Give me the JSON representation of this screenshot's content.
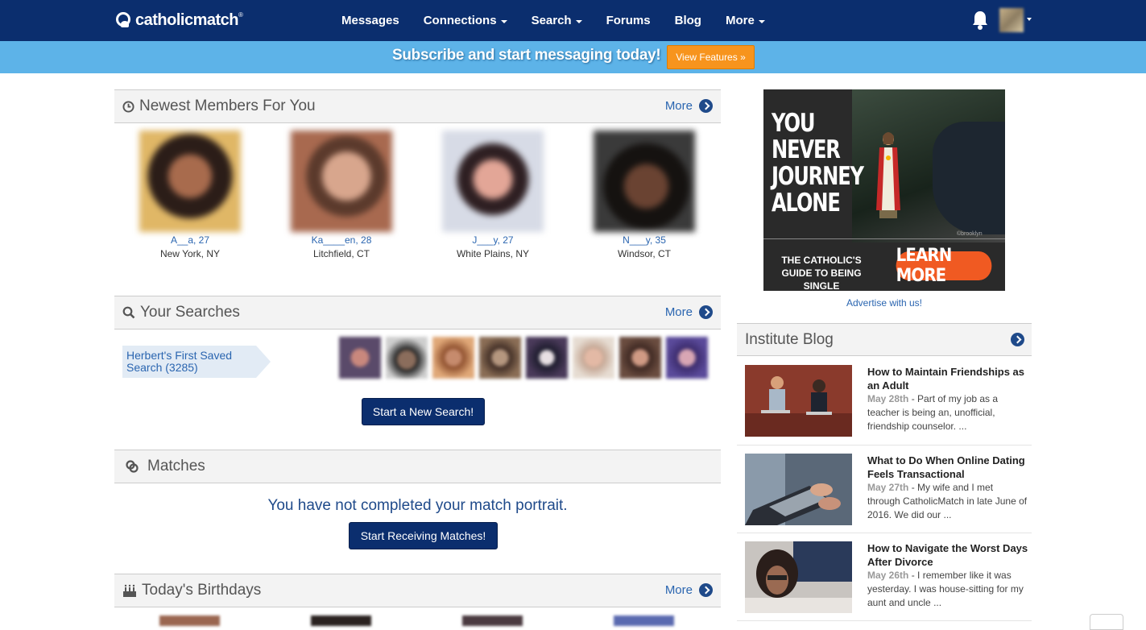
{
  "brand": {
    "name": "catholicmatch",
    "trademark": "®"
  },
  "nav": {
    "items": [
      {
        "label": "Messages",
        "dropdown": false
      },
      {
        "label": "Connections",
        "dropdown": true
      },
      {
        "label": "Search",
        "dropdown": true
      },
      {
        "label": "Forums",
        "dropdown": false
      },
      {
        "label": "Blog",
        "dropdown": false
      },
      {
        "label": "More",
        "dropdown": true
      }
    ],
    "icons": [
      "bell-icon",
      "avatar"
    ]
  },
  "promo": {
    "text": "Subscribe and start messaging today!",
    "button": "View Features »"
  },
  "newest": {
    "title": "Newest Members For You",
    "more": "More",
    "members": [
      {
        "name": "A__a, 27",
        "location": "New York, NY"
      },
      {
        "name": "Ka____en, 28",
        "location": "Litchfield, CT"
      },
      {
        "name": "J___y, 27",
        "location": "White Plains, NY"
      },
      {
        "name": "N___y, 35",
        "location": "Windsor, CT"
      }
    ]
  },
  "searches": {
    "title": "Your Searches",
    "more": "More",
    "saved": "Herbert's First Saved Search (3285)",
    "new_search_button": "Start a New Search!"
  },
  "matches": {
    "title": "Matches",
    "message": "You have not completed your match portrait.",
    "button": "Start Receiving Matches!"
  },
  "birthdays": {
    "title": "Today's Birthdays",
    "more": "More"
  },
  "ad": {
    "headline": "YOU NEVER JOURNEY ALONE",
    "subtext": "THE CATHOLIC'S GUIDE TO BEING SINGLE",
    "button": "LEARN MORE",
    "credit": "©brooklyn",
    "advertise_link": "Advertise with us!"
  },
  "blog": {
    "title": "Institute Blog",
    "posts": [
      {
        "title": "How to Maintain Friendships as an Adult",
        "date": "May 28th",
        "excerpt": " - Part of my job as a teacher is being an, unofficial, friendship counselor. ..."
      },
      {
        "title": "What to Do When Online Dating Feels Transactional",
        "date": "May 27th",
        "excerpt": " - My wife and I met through CatholicMatch in late June of 2016. We did our ..."
      },
      {
        "title": "How to Navigate the Worst Days After Divorce",
        "date": "May 26th",
        "excerpt": " - I remember like it was yesterday. I was house-sitting for my aunt and uncle ..."
      }
    ]
  },
  "colors": {
    "nav": "#0b2e6e",
    "promo": "#5db3e8",
    "accent": "#f7941d",
    "link": "#2a65b0"
  }
}
